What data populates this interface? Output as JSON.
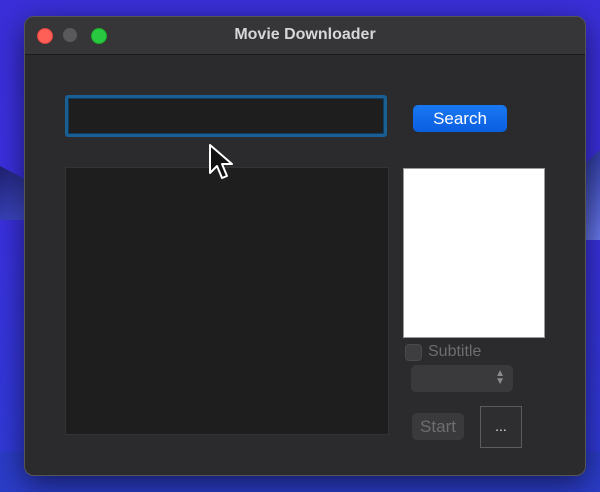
{
  "window": {
    "title": "Movie Downloader"
  },
  "search": {
    "value": "",
    "placeholder": "",
    "button_label": "Search"
  },
  "results": {
    "items": []
  },
  "options": {
    "subtitle_label": "Subtitle",
    "subtitle_checked": false,
    "language_selected": ""
  },
  "actions": {
    "start_label": "Start",
    "more_label": "..."
  },
  "colors": {
    "accent": "#0a6cf0",
    "focus_ring": "#1a5f92",
    "window_bg": "#2b2a2c",
    "close": "#fe5f57",
    "maximize": "#28c840"
  }
}
